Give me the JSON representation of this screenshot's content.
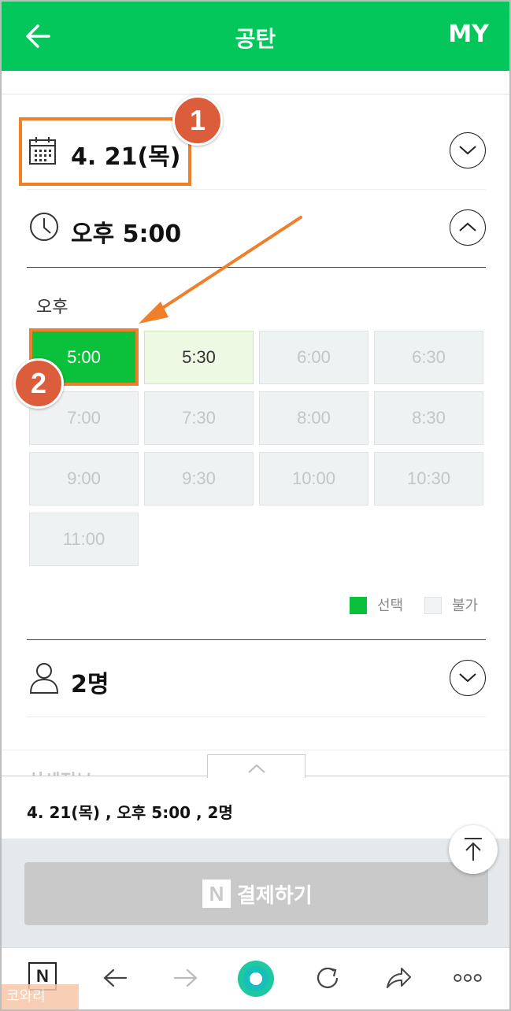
{
  "header": {
    "title": "공탄",
    "my_label": "MY"
  },
  "date_row": {
    "label": "4. 21(목)"
  },
  "time_row": {
    "label": "오후 5:00"
  },
  "time_picker": {
    "period_label": "오후",
    "slots": [
      {
        "label": "5:00",
        "state": "selected"
      },
      {
        "label": "5:30",
        "state": "available"
      },
      {
        "label": "6:00",
        "state": "unavailable"
      },
      {
        "label": "6:30",
        "state": "unavailable"
      },
      {
        "label": "7:00",
        "state": "unavailable"
      },
      {
        "label": "7:30",
        "state": "unavailable"
      },
      {
        "label": "8:00",
        "state": "unavailable"
      },
      {
        "label": "8:30",
        "state": "unavailable"
      },
      {
        "label": "9:00",
        "state": "unavailable"
      },
      {
        "label": "9:30",
        "state": "unavailable"
      },
      {
        "label": "10:00",
        "state": "unavailable"
      },
      {
        "label": "10:30",
        "state": "unavailable"
      },
      {
        "label": "11:00",
        "state": "unavailable"
      }
    ],
    "legend": {
      "selected": "선택",
      "unavailable": "불가"
    }
  },
  "people_row": {
    "label": "2명"
  },
  "detail_peek": "상세정보",
  "summary": {
    "text": "4. 21(목) , 오후 5:00 , 2명"
  },
  "pay_button": {
    "n_mark": "N",
    "label": "결제하기"
  },
  "browser_bar": {
    "n_mark": "N"
  },
  "annotations": {
    "badge1": "1",
    "badge2": "2"
  },
  "watermark": "코와리",
  "colors": {
    "brand": "#03c75a",
    "selected": "#0bc03b",
    "highlight": "#f07f2a",
    "badge": "#dc5d3c"
  }
}
